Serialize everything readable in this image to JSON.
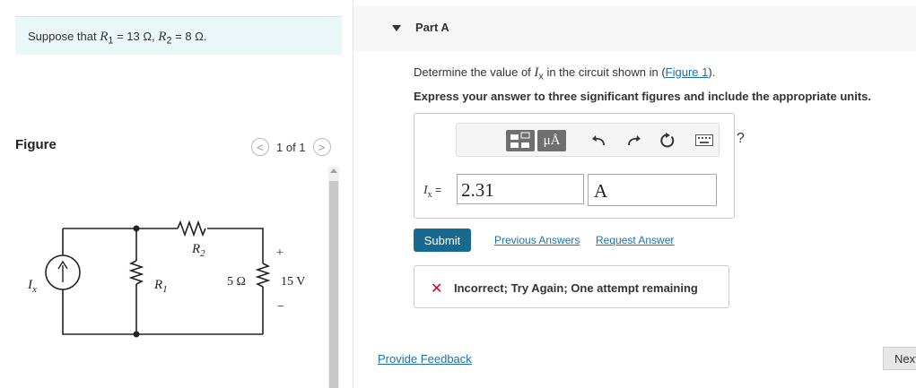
{
  "given": {
    "prefix": "Suppose that",
    "r1_sym": "R",
    "r1_sub": "1",
    "r1_val": " = 13 Ω,",
    "r2_sym": "R",
    "r2_sub": "2",
    "r2_val": " = 8 Ω."
  },
  "figure": {
    "label": "Figure",
    "pager_text": "1 of 1",
    "prev_symbol": "<",
    "next_symbol": ">"
  },
  "circuit": {
    "source_label": "I",
    "source_sub": "x",
    "r1_label": "R",
    "r1_sub": "1",
    "r2_label": "R",
    "r2_sub": "2",
    "resistor_label": "5 Ω",
    "voltage_label": "15 V",
    "plus": "+",
    "minus": "−"
  },
  "part": {
    "title": "Part A",
    "question_prefix": "Determine the value of ",
    "question_var": "I",
    "question_var_sub": "x",
    "question_mid": " in the circuit shown in (",
    "question_link": "Figure 1",
    "question_suffix": ").",
    "instruction": "Express your answer to three significant figures and include the appropriate units."
  },
  "answer": {
    "var_label": "I",
    "var_sub": "x",
    "equals": " =",
    "value": "2.31",
    "unit": "A",
    "toolbar": {
      "units_button": "μÅ",
      "help": "?",
      "icons": [
        "templates-icon",
        "units-icon",
        "undo-icon",
        "redo-icon",
        "reset-icon",
        "keyboard-icon",
        "help-icon"
      ]
    }
  },
  "actions": {
    "submit": "Submit",
    "previous_answers": "Previous Answers",
    "request_answer": "Request Answer"
  },
  "feedback": {
    "icon": "✕",
    "text": "Incorrect; Try Again; One attempt remaining"
  },
  "footer": {
    "provide_feedback": "Provide Feedback",
    "next": "Next"
  },
  "colors": {
    "given_bg": "#eaf6f7",
    "submit_bg": "#186990",
    "link": "#1c6fa8",
    "error": "#d0021b"
  }
}
